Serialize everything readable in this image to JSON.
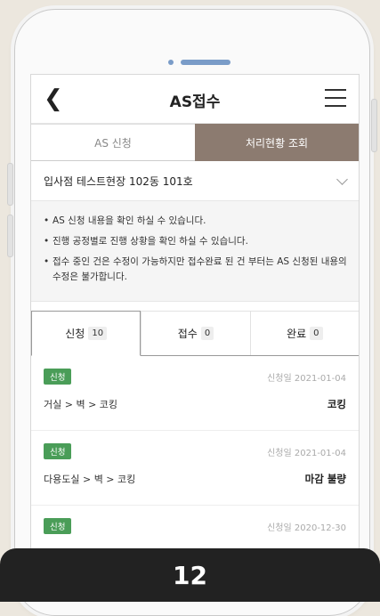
{
  "header": {
    "title": "AS접수"
  },
  "segments": {
    "apply": "AS 신청",
    "status": "처리현황 조회"
  },
  "site": {
    "selected": "입사점 테스트현장 102동 101호"
  },
  "notices": [
    {
      "bullet": "•",
      "text": "AS 신청 내용을 확인 하실 수 있습니다."
    },
    {
      "bullet": "•",
      "text": "진행 공정별로 진행 상황을 확인 하실 수 있습니다."
    },
    {
      "bullet": "•",
      "text": "접수 중인 건은 수정이 가능하지만 접수완료 된 건 부터는 AS 신청된 내용의 수정은 불가합니다."
    }
  ],
  "tabs": [
    {
      "label": "신청",
      "count": "10"
    },
    {
      "label": "접수",
      "count": "0"
    },
    {
      "label": "완료",
      "count": "0"
    }
  ],
  "items": [
    {
      "badge": "신청",
      "date": "신청일 2021-01-04",
      "path": "거실 > 벽 > 코킹",
      "type": "코킹"
    },
    {
      "badge": "신청",
      "date": "신청일 2021-01-04",
      "path": "다용도실 > 벽 > 코킹",
      "type": "마감 불량"
    },
    {
      "badge": "신청",
      "date": "신청일 2020-12-30",
      "path": "",
      "type": ""
    }
  ],
  "page_number": "12",
  "colors": {
    "accent": "#8c7b70",
    "badge": "#4a9d58",
    "dots": "#7a9cc8",
    "page_bar": "#222222",
    "background": "#ece7de"
  }
}
